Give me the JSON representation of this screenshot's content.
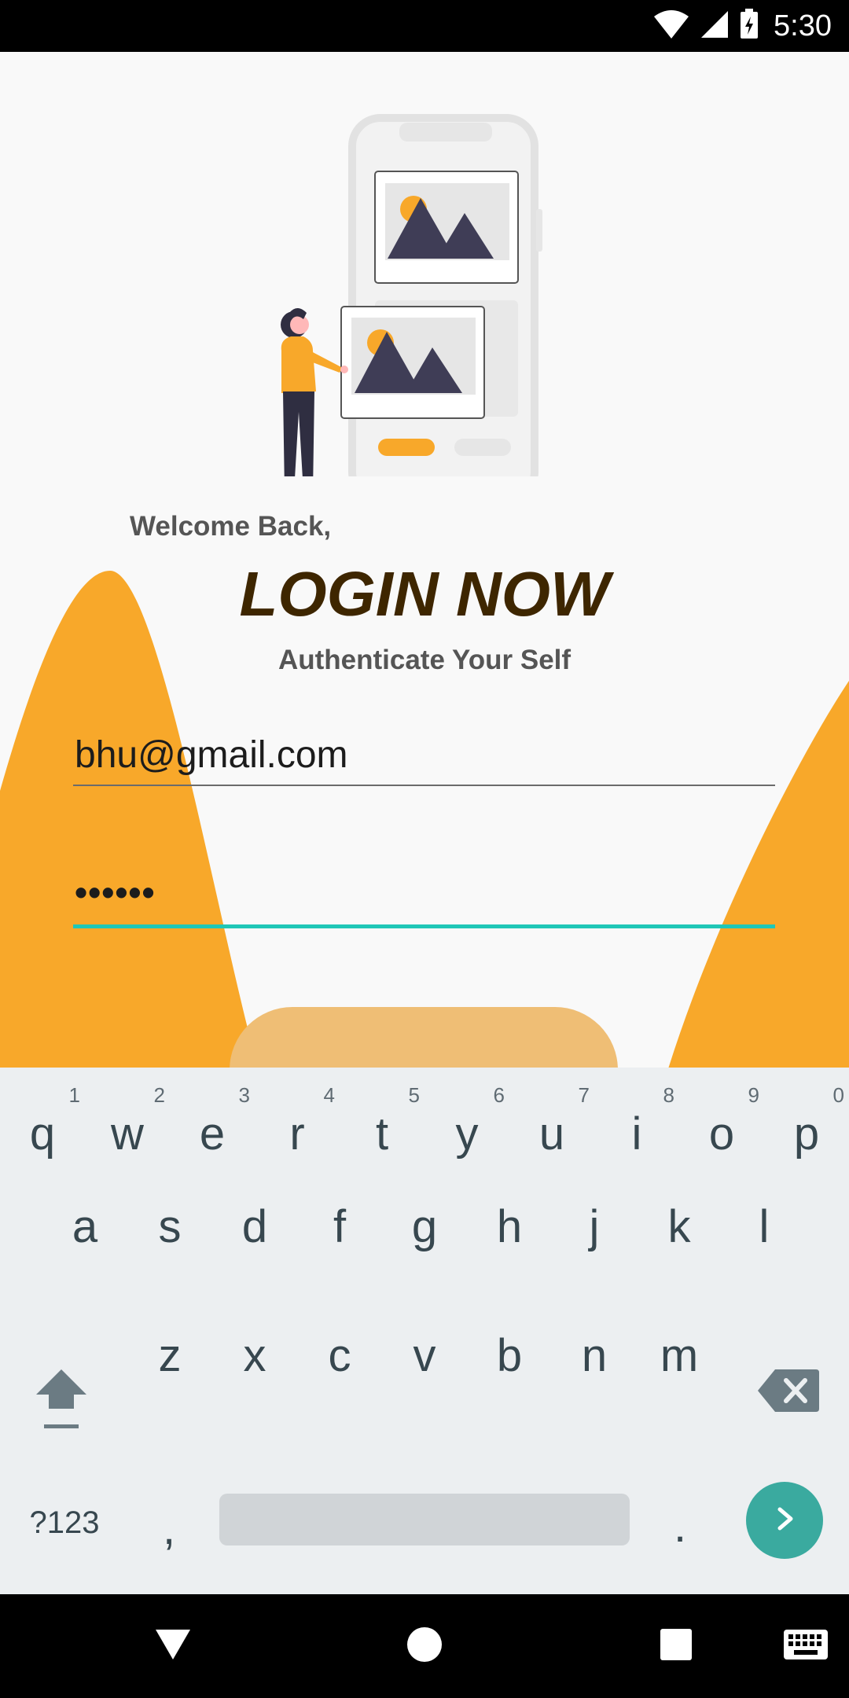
{
  "status_bar": {
    "time": "5:30"
  },
  "login": {
    "welcome": "Welcome Back,",
    "title": "LOGIN NOW",
    "subtitle": "Authenticate Your Self",
    "email_value": "bhu@gmail.com",
    "password_value": "••••••"
  },
  "colors": {
    "accent_orange": "#F8A82A",
    "button_faded": "#EFBE75",
    "title_brown": "#3E2600",
    "focus_teal": "#1FC7B7",
    "enter_teal": "#3AAA9F"
  },
  "keyboard": {
    "row1": [
      {
        "letter": "q",
        "hint": "1"
      },
      {
        "letter": "w",
        "hint": "2"
      },
      {
        "letter": "e",
        "hint": "3"
      },
      {
        "letter": "r",
        "hint": "4"
      },
      {
        "letter": "t",
        "hint": "5"
      },
      {
        "letter": "y",
        "hint": "6"
      },
      {
        "letter": "u",
        "hint": "7"
      },
      {
        "letter": "i",
        "hint": "8"
      },
      {
        "letter": "o",
        "hint": "9"
      },
      {
        "letter": "p",
        "hint": "0"
      }
    ],
    "row2": [
      "a",
      "s",
      "d",
      "f",
      "g",
      "h",
      "j",
      "k",
      "l"
    ],
    "row3": [
      "z",
      "x",
      "c",
      "v",
      "b",
      "n",
      "m"
    ],
    "symbols_label": "?123",
    "comma": ",",
    "period": ".",
    "icons": {
      "shift": "shift-icon",
      "backspace": "backspace-icon",
      "enter": "chevron-right-icon"
    }
  },
  "nav_bar": {
    "icons": [
      "back-icon",
      "home-icon",
      "recents-icon",
      "keyboard-icon"
    ]
  }
}
